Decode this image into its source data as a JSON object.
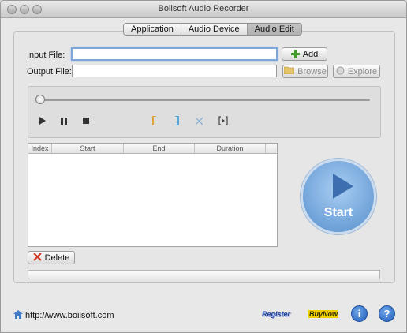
{
  "window": {
    "title": "Boilsoft Audio Recorder"
  },
  "tabs": [
    {
      "label": "Application"
    },
    {
      "label": "Audio Device"
    },
    {
      "label": "Audio Edit",
      "active": true
    }
  ],
  "form": {
    "input_label": "Input File:",
    "input_value": "",
    "output_label": "Output File:",
    "output_value": "",
    "add_label": "Add",
    "browse_label": "Browse",
    "explore_label": "Explore"
  },
  "player": {
    "position_fraction": 0.0,
    "controls": [
      "play-icon",
      "pause-icon",
      "stop-icon",
      "mark-start-icon",
      "mark-end-icon",
      "cut-icon",
      "play-selection-icon"
    ]
  },
  "table": {
    "columns": [
      "Index",
      "Start",
      "End",
      "Duration"
    ],
    "rows": []
  },
  "buttons": {
    "delete_label": "Delete",
    "start_label": "Start"
  },
  "footer": {
    "url": "http://www.boilsoft.com",
    "register_label": "Register",
    "buynow_label": "BuyNow",
    "info_label": "i",
    "help_label": "?"
  },
  "colors": {
    "accent_blue": "#6fa2d8",
    "link_blue": "#1c3f9a",
    "buy_yellow": "#f0d000",
    "delete_red": "#d23a2a",
    "add_green": "#3f9a2a"
  }
}
